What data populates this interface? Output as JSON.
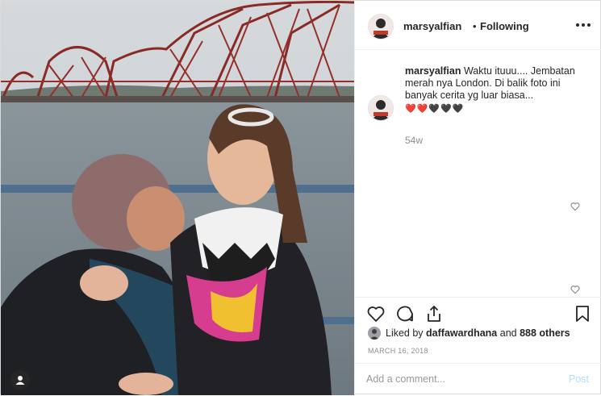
{
  "post": {
    "username": "marsyalfian",
    "separator": "•",
    "follow_status": "Following",
    "caption_username": "marsyalfian",
    "caption_text": "Waktu ituuu.... Jembatan merah nya London. Di balik foto ini banyak cerita yg luar biasa...",
    "caption_emojis": "❤️❤️🖤🖤🖤",
    "time_ago": "54w",
    "liked_by_prefix": "Liked by",
    "liked_by_user": "daffawardhana",
    "liked_by_and": "and",
    "liked_by_others": "888 others",
    "date": "MARCH 16, 2018",
    "comment_placeholder": "Add a comment...",
    "post_label": "Post"
  },
  "icons": {
    "more": "more-options-icon",
    "like": "heart-icon",
    "comment": "comment-icon",
    "share": "share-icon",
    "save": "bookmark-icon",
    "tag": "user-tag-icon"
  },
  "colors": {
    "text": "#262626",
    "muted": "#8e8e8e",
    "post_disabled": "#b2dffc",
    "heart_red": "#ed4956"
  }
}
